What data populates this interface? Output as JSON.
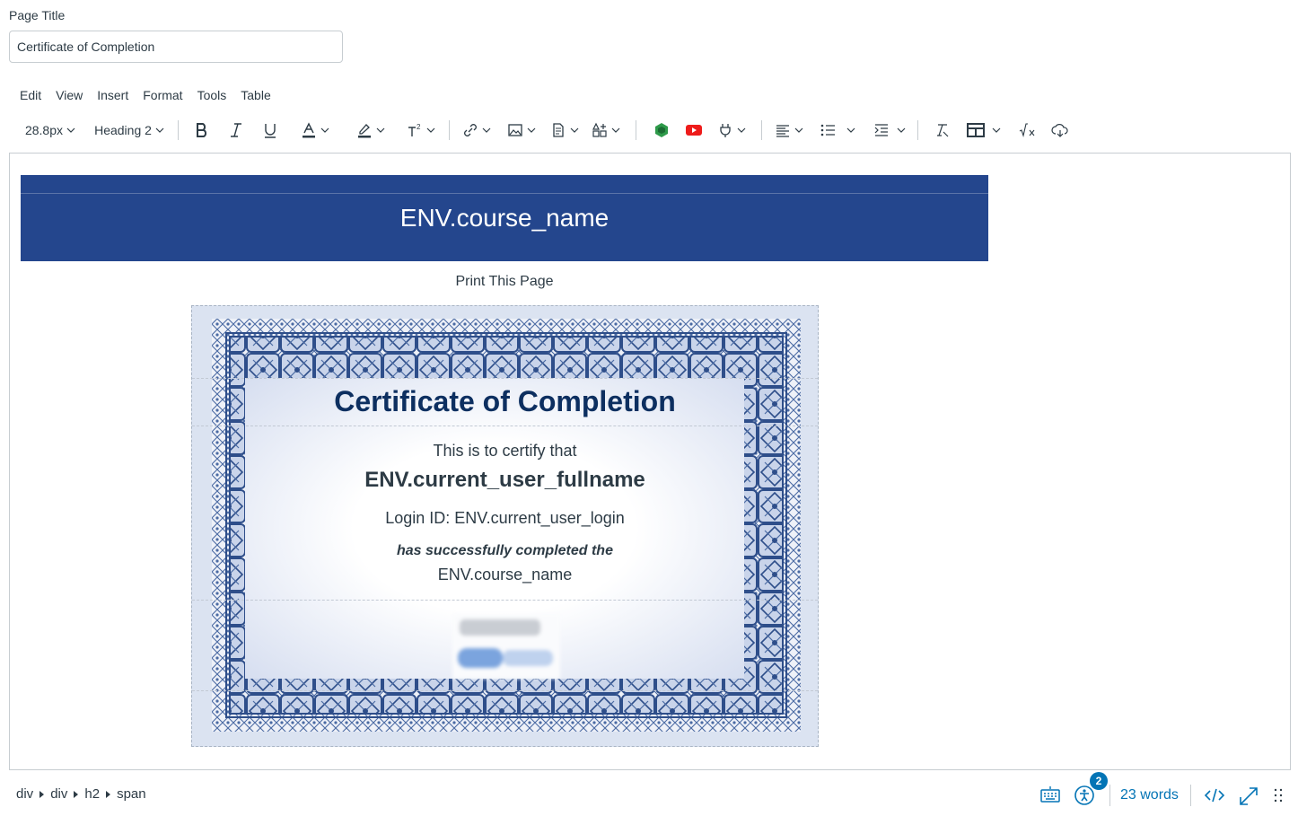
{
  "page_title": {
    "label": "Page Title",
    "value": "Certificate of Completion"
  },
  "menubar": [
    "Edit",
    "View",
    "Insert",
    "Format",
    "Tools",
    "Table"
  ],
  "toolbar": {
    "font_size": "28.8px",
    "block_format": "Heading 2",
    "icons": [
      "bold-icon",
      "italic-icon",
      "underline-icon",
      "text-color-icon",
      "highlight-color-icon",
      "superscript-icon",
      "link-icon",
      "image-icon",
      "document-icon",
      "apps-icon",
      "office-icon",
      "youtube-icon",
      "plug-icon",
      "align-icon",
      "bullet-list-icon",
      "indent-icon",
      "clear-format-icon",
      "table-icon",
      "math-icon",
      "cloud-icon"
    ]
  },
  "content": {
    "banner_text": "ENV.course_name",
    "print_link": "Print This Page",
    "certificate": {
      "title": "Certificate of Completion",
      "line1": "This is to certify that",
      "user": "ENV.current_user_fullname",
      "login": "Login ID: ENV.current_user_login",
      "completed": "has successfully completed the",
      "course": "ENV.course_name"
    }
  },
  "statusbar": {
    "breadcrumbs": [
      "div",
      "div",
      "h2",
      "span"
    ],
    "a11y_badge": "2",
    "word_count": "23 words"
  },
  "colors": {
    "banner": "#24468d",
    "cert_title": "#0d2f60",
    "link_blue": "#0374b5",
    "border_blue": "#3b5998"
  }
}
